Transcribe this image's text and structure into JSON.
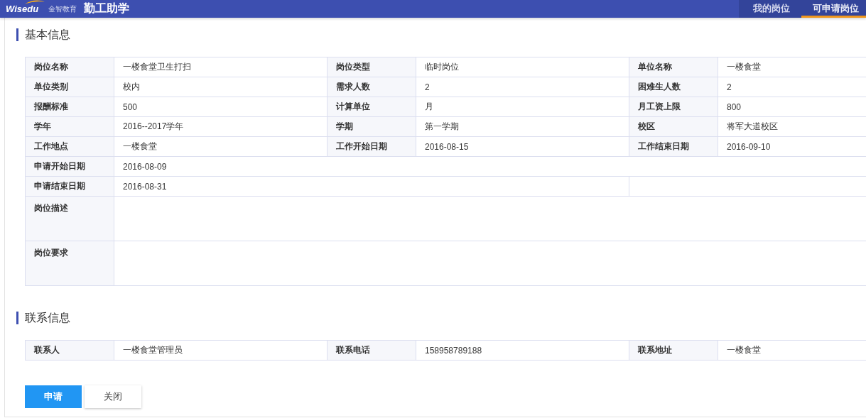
{
  "header": {
    "logo_text": "Wisedu",
    "logo_subtext": "金智教育",
    "title": "勤工助学",
    "tabs": [
      {
        "label": "我的岗位",
        "selected": false
      },
      {
        "label": "可申请岗位",
        "selected": true
      }
    ]
  },
  "sections": [
    {
      "title": "基本信息",
      "rows": [
        {
          "kind": "pairs",
          "pairs": [
            {
              "label": "岗位名称",
              "value": "一楼食堂卫生打扫"
            },
            {
              "label": "岗位类型",
              "value": "临时岗位"
            },
            {
              "label": "单位名称",
              "value": "一楼食堂"
            }
          ]
        },
        {
          "kind": "pairs",
          "pairs": [
            {
              "label": "单位类别",
              "value": "校内"
            },
            {
              "label": "需求人数",
              "value": "2"
            },
            {
              "label": "困难生人数",
              "value": "2"
            }
          ]
        },
        {
          "kind": "pairs",
          "pairs": [
            {
              "label": "报酬标准",
              "value": "500"
            },
            {
              "label": "计算单位",
              "value": "月"
            },
            {
              "label": "月工资上限",
              "value": "800"
            }
          ]
        },
        {
          "kind": "pairs",
          "pairs": [
            {
              "label": "学年",
              "value": "2016--2017学年"
            },
            {
              "label": "学期",
              "value": "第一学期"
            },
            {
              "label": "校区",
              "value": "将军大道校区"
            }
          ]
        },
        {
          "kind": "pairs",
          "pairs": [
            {
              "label": "工作地点",
              "value": "一楼食堂"
            },
            {
              "label": "工作开始日期",
              "value": "2016-08-15"
            },
            {
              "label": "工作结束日期",
              "value": "2016-09-10"
            }
          ]
        },
        {
          "kind": "full",
          "label": "申请开始日期",
          "value": "2016-08-09"
        },
        {
          "kind": "partial",
          "label": "申请结束日期",
          "value": "2016-08-31"
        },
        {
          "kind": "tall",
          "label": "岗位描述"
        },
        {
          "kind": "tall",
          "label": "岗位要求"
        }
      ]
    },
    {
      "title": "联系信息",
      "rows": [
        {
          "kind": "pairs",
          "pairs": [
            {
              "label": "联系人",
              "value": "一楼食堂管理员"
            },
            {
              "label": "联系电话",
              "value": "158958789188"
            },
            {
              "label": "联系地址",
              "value": "一楼食堂"
            }
          ]
        }
      ]
    }
  ],
  "buttons": [
    {
      "label": "申请",
      "kind": "primary"
    },
    {
      "label": "关闭",
      "kind": "default"
    }
  ]
}
